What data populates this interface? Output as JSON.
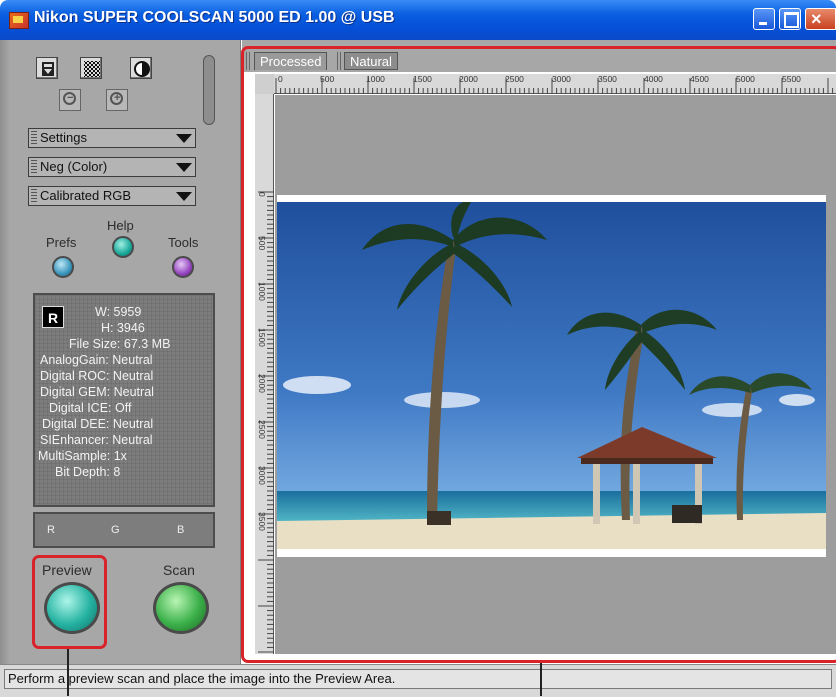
{
  "window": {
    "title": "Nikon SUPER COOLSCAN 5000 ED 1.00 @ USB",
    "controls": {
      "minimize": "minimize",
      "maximize": "maximize",
      "close": "×"
    }
  },
  "left_panel": {
    "tools": [
      {
        "name": "scan-window-toggle-icon"
      },
      {
        "name": "checker-pattern-icon"
      },
      {
        "name": "contrast-icon"
      }
    ],
    "zoom": {
      "out": "−",
      "in": "+"
    },
    "dropdowns": [
      "Settings",
      "Neg (Color)",
      "Calibrated RGB"
    ],
    "help_label": "Help",
    "prefs_label": "Prefs",
    "tools_label": "Tools",
    "info": {
      "badge": "R",
      "width": "W: 5959",
      "height": "H: 3946",
      "file_size": "File Size: 67.3 MB",
      "analog_gain": "AnalogGain: Neutral",
      "digital_roc": "Digital ROC: Neutral",
      "digital_gem": "Digital GEM: Neutral",
      "digital_ice": "Digital ICE: Off",
      "digital_dee": "Digital DEE: Neutral",
      "si_enhancer": "SIEnhancer: Neutral",
      "multisample": "MultiSample: 1x",
      "bit_depth": "Bit Depth: 8"
    },
    "rgb": [
      "R",
      "G",
      "B"
    ],
    "preview_label": "Preview",
    "scan_label": "Scan"
  },
  "preview_area": {
    "tabs": [
      "Processed",
      "Natural"
    ],
    "h_ruler": [
      "0",
      "500",
      "1000",
      "1500",
      "2000",
      "2500",
      "3000",
      "3500",
      "4000",
      "4500",
      "5000",
      "5500"
    ],
    "v_ruler": [
      "0",
      "500",
      "1000",
      "1500",
      "2000",
      "2500",
      "3000",
      "3500"
    ]
  },
  "status_bar": {
    "text": "Perform a preview scan and place the image into the Preview Area."
  },
  "colors": {
    "callout": "#d8232a",
    "titlebar": "#0a5fe0",
    "panel": "#a7a7a7"
  }
}
